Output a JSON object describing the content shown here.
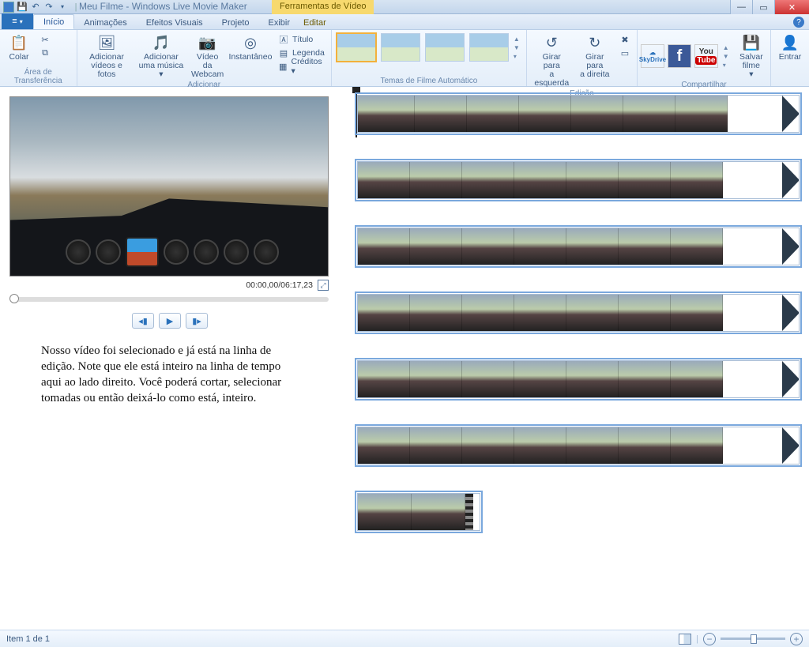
{
  "title": {
    "doc": "Meu Filme",
    "app": "Windows Live Movie Maker"
  },
  "contextual_tab": "Ferramentas de Vídeo",
  "tabs": {
    "inicio": "Início",
    "animacoes": "Animações",
    "efeitos": "Efeitos Visuais",
    "projeto": "Projeto",
    "exibir": "Exibir",
    "editar": "Editar"
  },
  "ribbon": {
    "groups": {
      "clipboard": "Área de Transferência",
      "add": "Adicionar",
      "themes": "Temas de Filme Automático",
      "edit": "Edição",
      "share": "Compartilhar"
    },
    "paste": "Colar",
    "add_videos": "Adicionar\nvídeos e fotos",
    "add_music": "Adicionar\numa música ▾",
    "webcam": "Vídeo da\nWebcam",
    "snapshot": "Instantâneo",
    "title_btn": "Título",
    "caption_btn": "Legenda",
    "credits_btn": "Créditos ▾",
    "rotate_left": "Girar para\na esquerda",
    "rotate_right": "Girar para\na direita",
    "save_movie": "Salvar\nfilme ▾",
    "signin": "Entrar",
    "share": {
      "skydrive": "SkyDrive",
      "facebook": "f",
      "youtube1": "You",
      "youtube2": "Tube"
    }
  },
  "preview": {
    "time": "00:00,00/06:17,23"
  },
  "caption_text": "Nosso vídeo foi selecionado e já está na linha de edição. Note que ele está inteiro na linha de tempo aqui ao lado direito. Você poderá cortar, selecionar tomadas ou então deixá-lo como está, inteiro.",
  "status": {
    "item": "Item 1 de 1"
  }
}
